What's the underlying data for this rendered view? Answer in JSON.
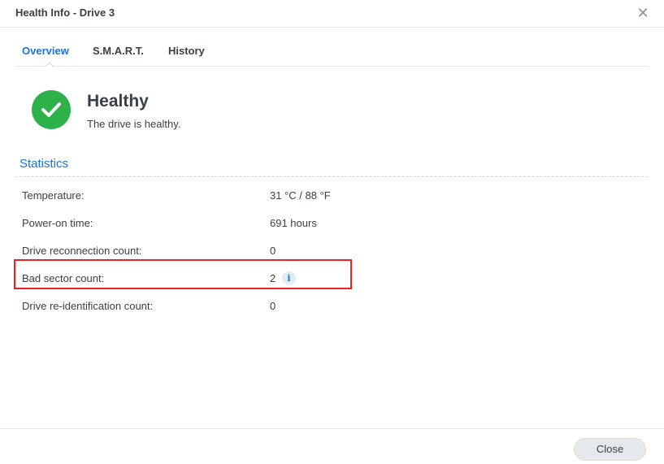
{
  "window": {
    "title": "Health Info - Drive 3",
    "close_icon": "close-icon"
  },
  "tabs": [
    {
      "label": "Overview",
      "active": true
    },
    {
      "label": "S.M.A.R.T.",
      "active": false
    },
    {
      "label": "History",
      "active": false
    }
  ],
  "status": {
    "icon": "check-circle-icon",
    "color": "#2db149",
    "heading": "Healthy",
    "description": "The drive is healthy."
  },
  "statistics": {
    "title": "Statistics",
    "rows": [
      {
        "label": "Temperature:",
        "value": "31 °C / 88 °F"
      },
      {
        "label": "Power-on time:",
        "value": "691 hours"
      },
      {
        "label": "Drive reconnection count:",
        "value": "0"
      },
      {
        "label": "Bad sector count:",
        "value": "2",
        "info_icon": "i",
        "highlighted": true
      },
      {
        "label": "Drive re-identification count:",
        "value": "0"
      }
    ]
  },
  "footer": {
    "close_label": "Close"
  },
  "colors": {
    "accent": "#1a74d3",
    "healthy": "#2db149",
    "highlight": "#e8231e"
  }
}
